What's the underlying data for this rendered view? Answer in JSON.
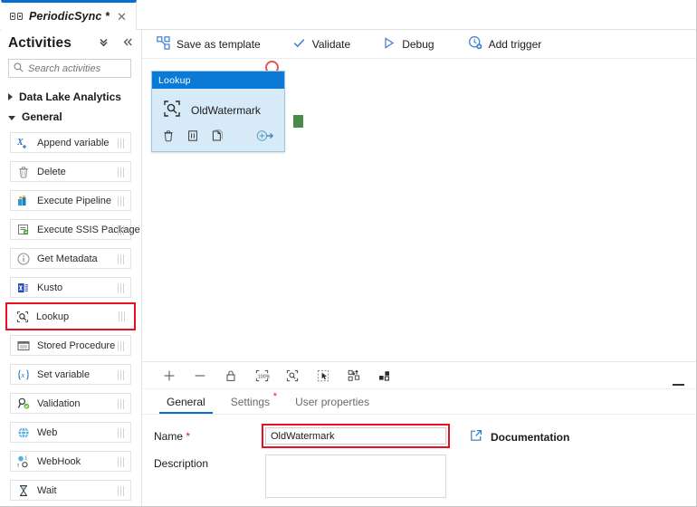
{
  "tab": {
    "icon": "pipeline-icon",
    "title": "PeriodicSync *",
    "close": "✕"
  },
  "sidebar": {
    "title": "Activities",
    "collapse_all_icon": "double-chevron-down-icon",
    "collapse_panel_icon": "double-chevron-left-icon",
    "search": {
      "placeholder": "Search activities",
      "value": "",
      "icon": "search-icon"
    },
    "groups": [
      {
        "label": "Data Lake Analytics",
        "expanded": false
      },
      {
        "label": "General",
        "expanded": true
      }
    ],
    "activities": [
      {
        "label": "Append variable",
        "icon": "append-variable-icon",
        "selected": false
      },
      {
        "label": "Delete",
        "icon": "delete-icon",
        "selected": false
      },
      {
        "label": "Execute Pipeline",
        "icon": "execute-pipeline-icon",
        "selected": false
      },
      {
        "label": "Execute SSIS Package",
        "icon": "execute-ssis-package-icon",
        "selected": false
      },
      {
        "label": "Get Metadata",
        "icon": "get-metadata-icon",
        "selected": false
      },
      {
        "label": "Kusto",
        "icon": "kusto-icon",
        "selected": false
      },
      {
        "label": "Lookup",
        "icon": "lookup-icon",
        "selected": true
      },
      {
        "label": "Stored Procedure",
        "icon": "stored-procedure-icon",
        "selected": false
      },
      {
        "label": "Set variable",
        "icon": "set-variable-icon",
        "selected": false
      },
      {
        "label": "Validation",
        "icon": "validation-icon",
        "selected": false
      },
      {
        "label": "Web",
        "icon": "web-icon",
        "selected": false
      },
      {
        "label": "WebHook",
        "icon": "webhook-icon",
        "selected": false
      },
      {
        "label": "Wait",
        "icon": "wait-icon",
        "selected": false
      }
    ]
  },
  "commandbar": [
    {
      "label": "Save as template",
      "icon": "save-as-template-icon"
    },
    {
      "label": "Validate",
      "icon": "checkmark-icon"
    },
    {
      "label": "Debug",
      "icon": "play-icon"
    },
    {
      "label": "Add trigger",
      "icon": "add-trigger-icon"
    }
  ],
  "canvas": {
    "node": {
      "type_label": "Lookup",
      "name": "OldWatermark",
      "type_icon": "lookup-icon",
      "tools": [
        {
          "name": "delete-activity-icon"
        },
        {
          "name": "clone-activity-icon"
        },
        {
          "name": "copy-activity-icon"
        },
        {
          "name": "add-output-icon"
        }
      ],
      "output_handle": "success-output-handle",
      "selection_marker": "selection-circle"
    }
  },
  "zoombar": {
    "buttons": [
      {
        "name": "zoom-in-icon"
      },
      {
        "name": "zoom-out-icon"
      },
      {
        "name": "lock-icon"
      },
      {
        "name": "zoom-to-100-icon"
      },
      {
        "name": "zoom-to-fit-icon"
      },
      {
        "name": "selection-mode-icon"
      },
      {
        "name": "auto-align-icon"
      },
      {
        "name": "layout-icon"
      }
    ],
    "minimize": "collapse-panel-icon"
  },
  "properties": {
    "tabs": [
      {
        "label": "General",
        "active": true,
        "required": false
      },
      {
        "label": "Settings",
        "active": false,
        "required": true
      },
      {
        "label": "User properties",
        "active": false,
        "required": false
      }
    ],
    "required_marker": "*",
    "fields": {
      "name": {
        "label": "Name",
        "required_star": "*",
        "value": "OldWatermark",
        "placeholder": ""
      },
      "description": {
        "label": "Description",
        "value": "",
        "placeholder": ""
      }
    },
    "documentation": {
      "label": "Documentation",
      "icon": "external-link-icon"
    }
  }
}
